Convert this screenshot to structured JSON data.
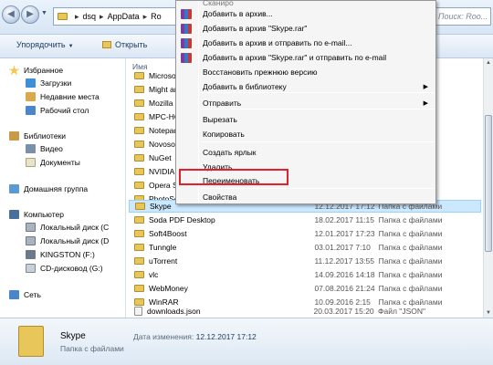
{
  "address": {
    "segments": [
      "dsq",
      "AppData",
      "Ro"
    ],
    "search_placeholder": "Поиск: Roo..."
  },
  "toolbar": {
    "organize": "Упорядочить",
    "open": "Открыть"
  },
  "sidebar": {
    "favorites": "Избранное",
    "downloads": "Загрузки",
    "recent": "Недавние места",
    "desktop": "Рабочий стол",
    "libraries": "Библиотеки",
    "video": "Видео",
    "documents": "Документы",
    "homegroup": "Домашняя группа",
    "computer": "Компьютер",
    "local_c": "Локальный диск (C",
    "local_d": "Локальный диск (D",
    "kingston": "KINGSTON (F:)",
    "cd": "CD-дисковод (G:)",
    "network": "Сеть"
  },
  "list": {
    "col_name": "Имя",
    "rows": [
      {
        "name": "Microsoft",
        "date": "",
        "type": ""
      },
      {
        "name": "Might an",
        "date": "",
        "type": ""
      },
      {
        "name": "Mozilla",
        "date": "",
        "type": ""
      },
      {
        "name": "MPC-HC",
        "date": "",
        "type": ""
      },
      {
        "name": "Notepad",
        "date": "",
        "type": ""
      },
      {
        "name": "Novosoft",
        "date": "",
        "type": ""
      },
      {
        "name": "NuGet",
        "date": "",
        "type": ""
      },
      {
        "name": "NVIDIA",
        "date": "",
        "type": ""
      },
      {
        "name": "Opera S",
        "date": "",
        "type": ""
      },
      {
        "name": "PhotoSc",
        "date": "",
        "type": ""
      },
      {
        "name": "Skype",
        "date": "12.12.2017 17:12",
        "type": "Папка с файлами"
      },
      {
        "name": "Soda PDF Desktop",
        "date": "18.02.2017 11:15",
        "type": "Папка с файлами"
      },
      {
        "name": "Soft4Boost",
        "date": "12.01.2017 17:23",
        "type": "Папка с файлами"
      },
      {
        "name": "Tunngle",
        "date": "03.01.2017 7:10",
        "type": "Папка с файлами"
      },
      {
        "name": "uTorrent",
        "date": "11.12.2017 13:55",
        "type": "Папка с файлами"
      },
      {
        "name": "vlc",
        "date": "14.09.2016 14:18",
        "type": "Папка с файлами"
      },
      {
        "name": "WebMoney",
        "date": "07.08.2016 21:24",
        "type": "Папка с файлами"
      },
      {
        "name": "WinRAR",
        "date": "10.09.2016 2:15",
        "type": "Папка с файлами"
      },
      {
        "name": "downloads.json",
        "date": "20.03.2017 15:20",
        "type": "Файл \"JSON\""
      }
    ]
  },
  "details": {
    "name": "Skype",
    "type": "Папка с файлами",
    "date_label": "Дата изменения:",
    "date_value": "12.12.2017 17:12"
  },
  "context_menu": {
    "top_partial": "Сканиро",
    "add_archive": "Добавить в архив...",
    "add_skype_rar": "Добавить в архив \"Skype.rar\"",
    "add_email": "Добавить в архив и отправить по e-mail...",
    "add_skype_email": "Добавить в архив \"Skype.rar\" и отправить по e-mail",
    "restore": "Восстановить прежнюю версию",
    "add_library": "Добавить в библиотеку",
    "send_to": "Отправить",
    "cut": "Вырезать",
    "copy": "Копировать",
    "create_shortcut": "Создать ярлык",
    "delete": "Удалить",
    "rename": "Переименовать",
    "properties": "Свойства"
  },
  "colors": {
    "highlight_box": "#e3202c",
    "selection": "#cce8ff"
  }
}
